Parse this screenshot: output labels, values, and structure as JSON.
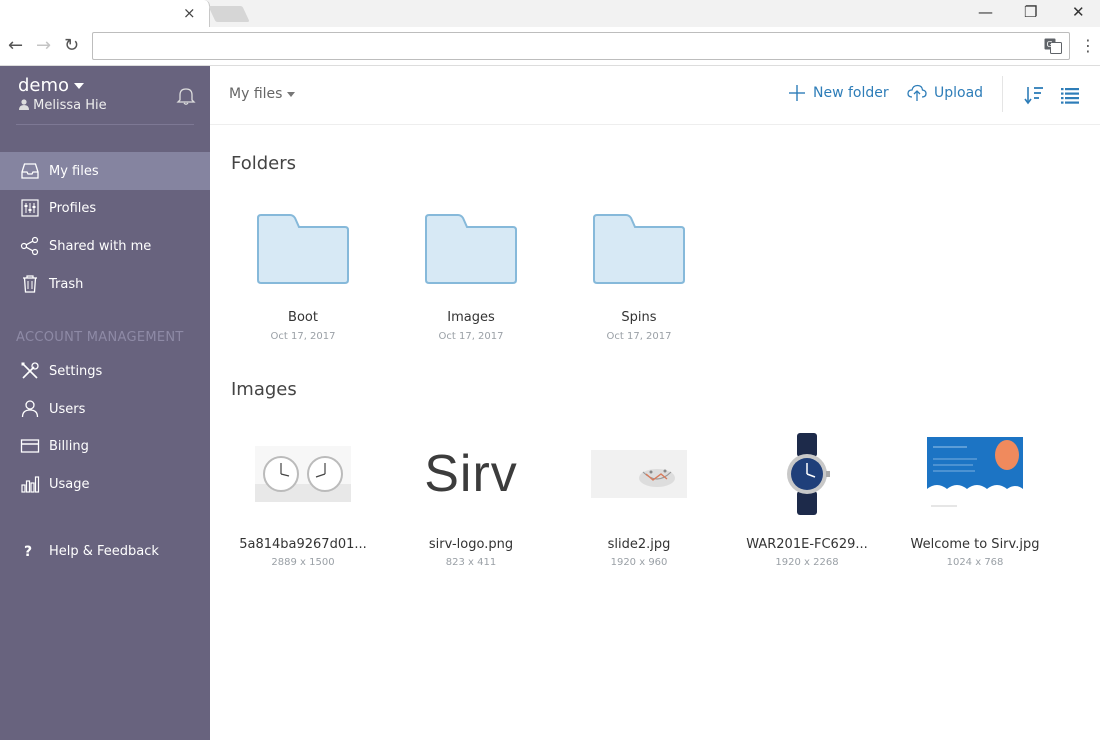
{
  "browser": {
    "tab_close": "×",
    "nav_back": "←",
    "nav_forward": "→",
    "nav_reload": "↻",
    "address_value": "",
    "win_minimize": "—",
    "win_restore": "❐",
    "win_close": "✕",
    "menu": "⋮"
  },
  "sidebar": {
    "account": "demo",
    "user": "Melissa Hie",
    "items": [
      {
        "label": "My files",
        "icon": "inbox-icon",
        "active": true
      },
      {
        "label": "Profiles",
        "icon": "sliders-icon"
      },
      {
        "label": "Shared with me",
        "icon": "share-icon"
      },
      {
        "label": "Trash",
        "icon": "trash-icon"
      }
    ],
    "section_label": "ACCOUNT MANAGEMENT",
    "account_items": [
      {
        "label": "Settings",
        "icon": "tools-icon"
      },
      {
        "label": "Users",
        "icon": "user-icon"
      },
      {
        "label": "Billing",
        "icon": "card-icon"
      },
      {
        "label": "Usage",
        "icon": "bar-chart-icon"
      }
    ],
    "help": {
      "label": "Help & Feedback",
      "icon": "question-icon"
    }
  },
  "main": {
    "breadcrumb": "My files",
    "new_folder": "New folder",
    "upload": "Upload",
    "folders_title": "Folders",
    "folders": [
      {
        "name": "Boot",
        "date": "Oct 17, 2017"
      },
      {
        "name": "Images",
        "date": "Oct 17, 2017"
      },
      {
        "name": "Spins",
        "date": "Oct 17, 2017"
      }
    ],
    "images_title": "Images",
    "images": [
      {
        "name": "5a814ba9267d01...",
        "size": "2889 x 1500",
        "icon": "clocks-thumbnail"
      },
      {
        "name": "sirv-logo.png",
        "size": "823 x 411",
        "icon": "sirv-logo-thumbnail",
        "logo_text": "Sirv"
      },
      {
        "name": "slide2.jpg",
        "size": "1920 x 960",
        "icon": "slide-thumbnail"
      },
      {
        "name": "WAR201E-FC629...",
        "size": "1920 x 2268",
        "icon": "watch-thumbnail"
      },
      {
        "name": "Welcome to Sirv.jpg",
        "size": "1024 x 768",
        "icon": "welcome-thumbnail"
      }
    ]
  },
  "colors": {
    "sidebar_bg": "#68637e",
    "sidebar_active": "#8584a0",
    "accent": "#2e7db8",
    "folder_fill": "#d7e9f5",
    "folder_stroke": "#86b9da"
  }
}
